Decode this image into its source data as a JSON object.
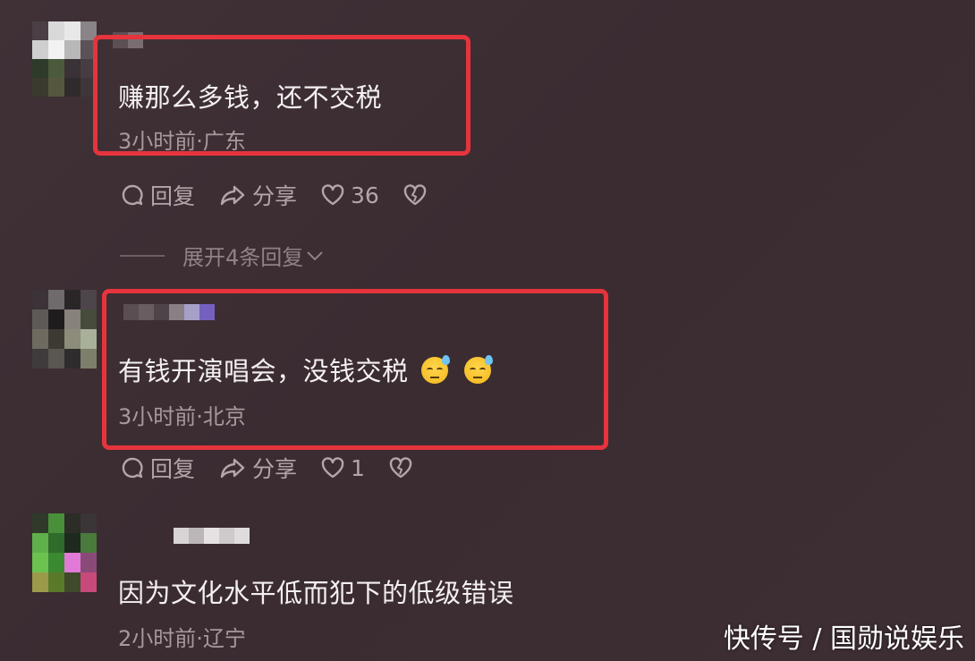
{
  "comments": [
    {
      "text": "赚那么多钱，还不交税",
      "meta": "3小时前·广东",
      "reply_label": "回复",
      "share_label": "分享",
      "likes": "36"
    },
    {
      "text": "有钱开演唱会，没钱交税",
      "meta": "3小时前·北京",
      "reply_label": "回复",
      "share_label": "分享",
      "likes": "1",
      "emojis": [
        "sweat-emoji",
        "sweat-emoji"
      ]
    },
    {
      "text": "因为文化水平低而犯下的低级错误",
      "meta": "2小时前·辽宁"
    }
  ],
  "expand_replies": "展开4条回复",
  "watermark": "快传号 / 国勋说娱乐",
  "colors": {
    "highlight_border": "#e6343c",
    "background": "#3b2d32",
    "meta_text": "#a8999d"
  }
}
